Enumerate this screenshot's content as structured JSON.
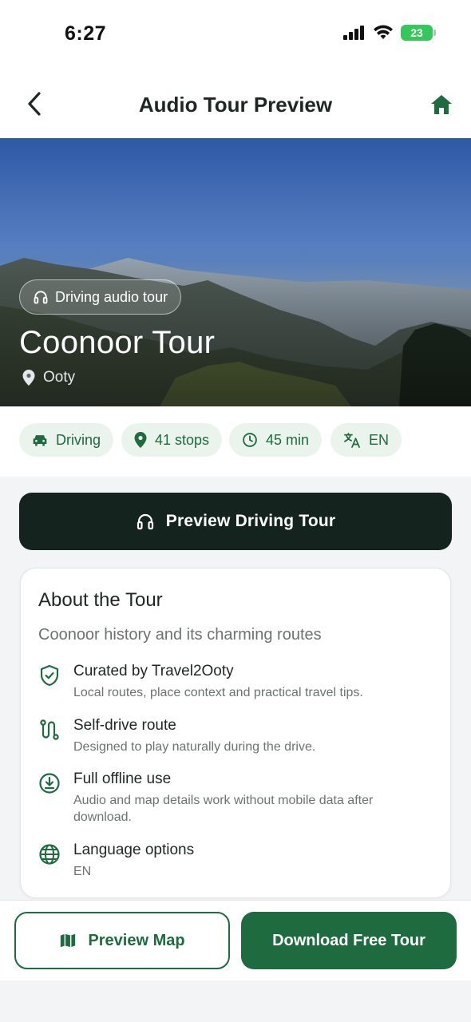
{
  "status_bar": {
    "time": "6:27",
    "battery": "23"
  },
  "nav": {
    "title": "Audio Tour Preview",
    "back_icon": "chevron-left-icon",
    "home_icon": "home-icon"
  },
  "hero": {
    "badge": "Driving audio tour",
    "badge_icon": "headphones-icon",
    "title": "Coonoor Tour",
    "location": "Ooty",
    "location_icon": "map-pin-icon"
  },
  "chips": [
    {
      "label": "Driving",
      "icon": "car-icon"
    },
    {
      "label": "41 stops",
      "icon": "map-pin-icon"
    },
    {
      "label": "45 min",
      "icon": "clock-icon"
    },
    {
      "label": "EN",
      "icon": "translate-icon"
    }
  ],
  "preview_button": {
    "label": "Preview Driving Tour",
    "icon": "headphones-icon"
  },
  "about": {
    "heading": "About the Tour",
    "subtitle": "Coonoor history and its charming routes",
    "features": [
      {
        "title": "Curated by Travel2Ooty",
        "desc": "Local routes, place context and practical travel tips.",
        "icon": "shield-check-icon"
      },
      {
        "title": "Self-drive route",
        "desc": "Designed to play naturally during the drive.",
        "icon": "route-icon"
      },
      {
        "title": "Full offline use",
        "desc": "Audio and map details work without mobile data after download.",
        "icon": "download-circle-icon"
      },
      {
        "title": "Language options",
        "desc": "EN",
        "icon": "globe-icon"
      }
    ]
  },
  "bottom": {
    "map_button": "Preview Map",
    "map_icon": "map-icon",
    "download_button": "Download Free Tour"
  },
  "colors": {
    "brand_green": "#1d6b3e",
    "dark": "#14231d",
    "chip_bg": "#eaf3ec"
  }
}
